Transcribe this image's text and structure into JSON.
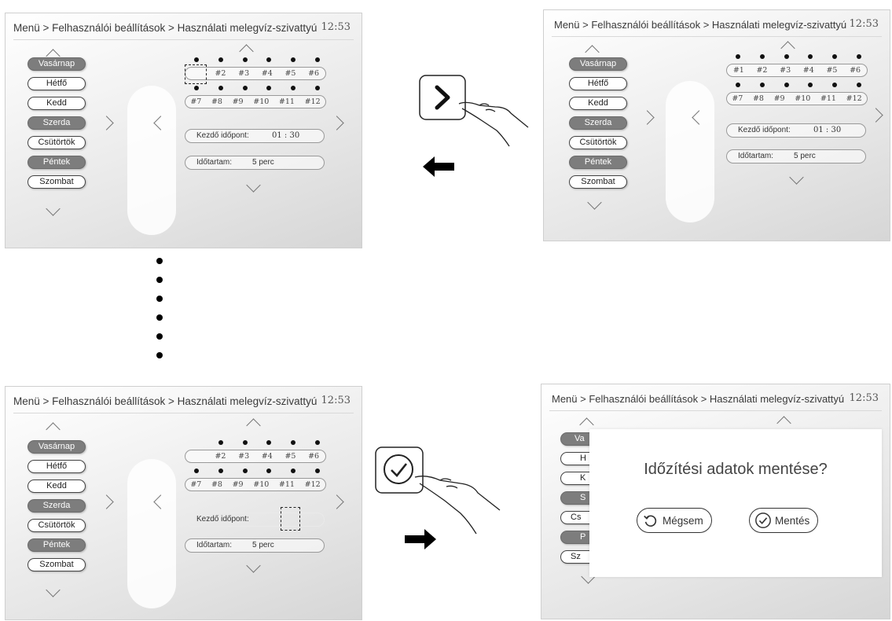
{
  "breadcrumb": "Menü > Felhasználói beállítások > Használati melegvíz-szivattyú",
  "clock": "12:53",
  "days": [
    {
      "label": "Vasárnap",
      "active": true
    },
    {
      "label": "Hétfő",
      "active": false
    },
    {
      "label": "Kedd",
      "active": false
    },
    {
      "label": "Szerda",
      "active": true
    },
    {
      "label": "Csütörtök",
      "active": false
    },
    {
      "label": "Péntek",
      "active": true
    },
    {
      "label": "Szombat",
      "active": false
    }
  ],
  "slots_row1": [
    "#1",
    "#2",
    "#3",
    "#4",
    "#5",
    "#6"
  ],
  "slots_row2": [
    "#7",
    "#8",
    "#9",
    "#10",
    "#11",
    "#12"
  ],
  "start_time": {
    "label": "Kezdő időpont:",
    "value": "01 : 30"
  },
  "duration": {
    "label": "Időtartam:",
    "value": "5 perc"
  },
  "dialog": {
    "title": "Időzítési adatok mentése?",
    "cancel_label": "Mégsem",
    "save_label": "Mentés"
  },
  "dialog_days_visible": [
    "Va",
    "H",
    "K",
    "S",
    "Cs",
    "P",
    "Sz"
  ],
  "colors": {
    "accent_dark": "#7d7d7d",
    "frame": "#cfcfcf",
    "arrow": "#000000"
  },
  "icons": [
    "chevron-up-icon",
    "chevron-down-icon",
    "chevron-left-icon",
    "chevron-right-icon",
    "hand-pointer-icon",
    "check-circle-icon",
    "undo-icon",
    "arrow-left-icon",
    "arrow-right-icon"
  ]
}
